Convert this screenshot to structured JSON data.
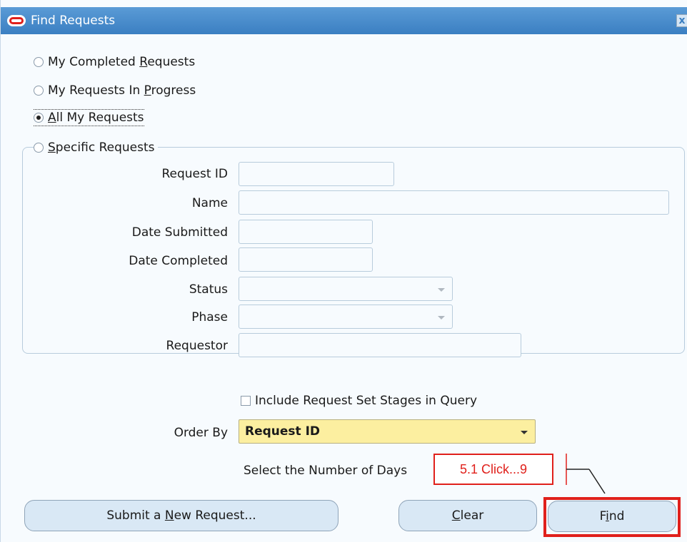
{
  "window": {
    "title": "Find Requests",
    "close_glyph": "x",
    "logo_icon": "oracle-logo-icon"
  },
  "radios": [
    {
      "pre": "My Completed ",
      "key": "R",
      "post": "equests",
      "checked": false
    },
    {
      "pre": "My Requests In ",
      "key": "P",
      "post": "rogress",
      "checked": false
    },
    {
      "pre": "",
      "key": "A",
      "post": "ll My Requests",
      "checked": true
    },
    {
      "pre": "",
      "key": "S",
      "post": "pecific Requests",
      "checked": false
    }
  ],
  "fields": {
    "request_id": {
      "label": "Request ID",
      "value": ""
    },
    "name": {
      "label": "Name",
      "value": ""
    },
    "date_submitted": {
      "label": "Date Submitted",
      "value": ""
    },
    "date_completed": {
      "label": "Date Completed",
      "value": ""
    },
    "status": {
      "label": "Status",
      "value": ""
    },
    "phase": {
      "label": "Phase",
      "value": ""
    },
    "requestor": {
      "label": "Requestor",
      "value": ""
    }
  },
  "include_stages": {
    "label": "Include Request Set Stages in Query",
    "checked": false
  },
  "order_by": {
    "label": "Order By",
    "value": "Request ID"
  },
  "days": {
    "label": "Select the Number of Days"
  },
  "callout": {
    "text": "5.1 Click...9"
  },
  "buttons": {
    "submit": {
      "pre": "Submit a ",
      "key": "N",
      "post": "ew Request..."
    },
    "clear": {
      "pre": "",
      "key": "C",
      "post": "lear"
    },
    "find": {
      "pre": "F",
      "key": "i",
      "post": "nd"
    }
  },
  "colors": {
    "title_bar": "#3b7fc2",
    "highlight": "#e0201b",
    "order_by_bg": "#fcefa0"
  }
}
